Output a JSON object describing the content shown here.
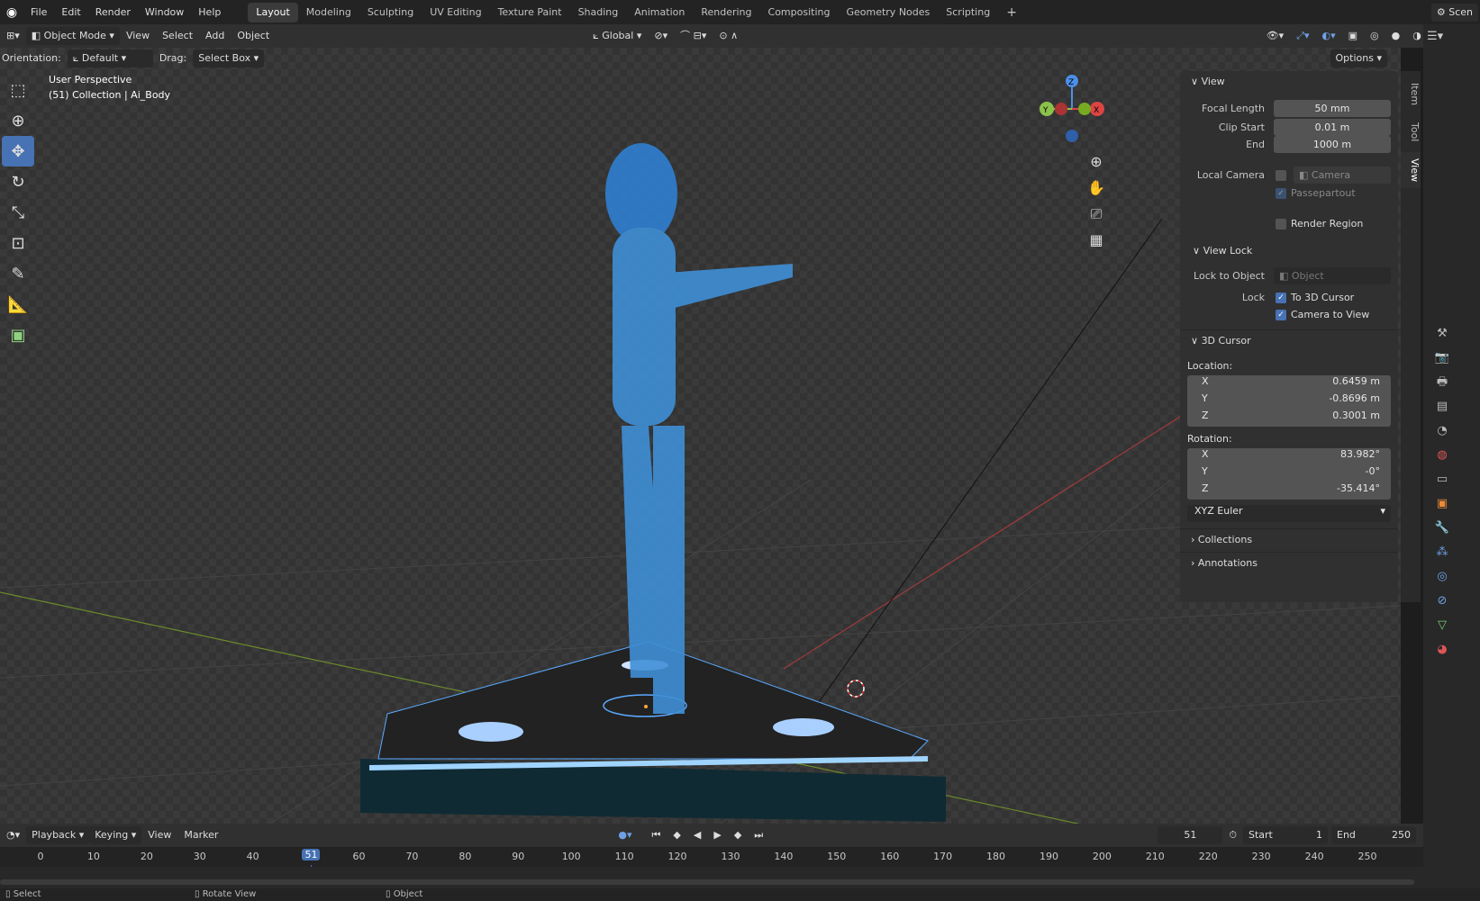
{
  "topbar": {
    "menus": [
      "File",
      "Edit",
      "Render",
      "Window",
      "Help"
    ],
    "workspaces": [
      "Layout",
      "Modeling",
      "Sculpting",
      "UV Editing",
      "Texture Paint",
      "Shading",
      "Animation",
      "Rendering",
      "Compositing",
      "Geometry Nodes",
      "Scripting"
    ],
    "active_workspace": "Layout",
    "scene_label": "Scen"
  },
  "header": {
    "mode": "Object Mode",
    "menus": [
      "View",
      "Select",
      "Add",
      "Object"
    ],
    "orientation_value": "Global",
    "options": "Options"
  },
  "subheader": {
    "orientation_label": "Orientation:",
    "orientation_value": "Default",
    "drag_label": "Drag:",
    "drag_value": "Select Box"
  },
  "viewport": {
    "perspective": "User Perspective",
    "collection": "(51) Collection | Ai_Body"
  },
  "npanel": {
    "tabs": [
      "Item",
      "Tool",
      "View"
    ],
    "view": {
      "title": "View",
      "focal_length_label": "Focal Length",
      "focal_length": "50 mm",
      "clip_start_label": "Clip Start",
      "clip_start": "0.01 m",
      "end_label": "End",
      "end": "1000 m",
      "local_camera_label": "Local Camera",
      "camera_placeholder": "Camera",
      "passepartout": "Passepartout",
      "render_region": "Render Region"
    },
    "view_lock": {
      "title": "View Lock",
      "lock_to_object_label": "Lock to Object",
      "object_placeholder": "Object",
      "lock_label": "Lock",
      "to_3d_cursor": "To 3D Cursor",
      "camera_to_view": "Camera to View"
    },
    "cursor": {
      "title": "3D Cursor",
      "location_label": "Location:",
      "location": [
        {
          "k": "X",
          "v": "0.6459 m"
        },
        {
          "k": "Y",
          "v": "-0.8696 m"
        },
        {
          "k": "Z",
          "v": "0.3001 m"
        }
      ],
      "rotation_label": "Rotation:",
      "rotation": [
        {
          "k": "X",
          "v": "83.982°"
        },
        {
          "k": "Y",
          "v": "-0°"
        },
        {
          "k": "Z",
          "v": "-35.414°"
        }
      ],
      "rotation_mode": "XYZ Euler"
    },
    "collections": "Collections",
    "annotations": "Annotations"
  },
  "timeline": {
    "menus": [
      "Playback",
      "Keying",
      "View",
      "Marker"
    ],
    "current_frame": "51",
    "start_label": "Start",
    "start": "1",
    "end_label": "End",
    "end": "250",
    "ticks": [
      "0",
      "10",
      "20",
      "30",
      "40",
      "51",
      "60",
      "70",
      "80",
      "90",
      "100",
      "110",
      "120",
      "130",
      "140",
      "150",
      "160",
      "170",
      "180",
      "190",
      "200",
      "210",
      "220",
      "230",
      "240",
      "250"
    ]
  },
  "statusbar": {
    "select": "Select",
    "rotate": "Rotate View",
    "object": "Object"
  },
  "colors": {
    "accent": "#4772b3",
    "panel": "#303030",
    "grid_red": "#a33a3a",
    "grid_green": "#6b8a2a"
  }
}
